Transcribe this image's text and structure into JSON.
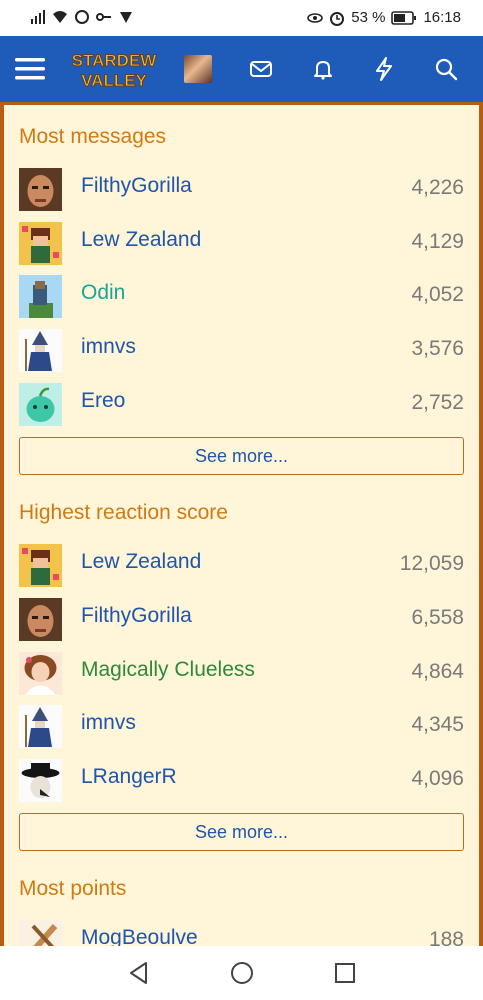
{
  "status": {
    "battery": "53 %",
    "time": "16:18"
  },
  "nav": {
    "logo_line1": "STARDEW",
    "logo_line2": "VALLEY"
  },
  "sections": [
    {
      "title": "Most messages",
      "rows": [
        {
          "name": "FilthyGorilla",
          "value": "4,226",
          "style": "blue",
          "avatar": "face"
        },
        {
          "name": "Lew Zealand",
          "value": "4,129",
          "style": "blue",
          "avatar": "yellow"
        },
        {
          "name": "Odin",
          "value": "4,052",
          "style": "teal",
          "avatar": "sky"
        },
        {
          "name": "imnvs",
          "value": "3,576",
          "style": "blue",
          "avatar": "wizard"
        },
        {
          "name": "Ereo",
          "value": "2,752",
          "style": "blue",
          "avatar": "junimo"
        }
      ],
      "see_more": "See more..."
    },
    {
      "title": "Highest reaction score",
      "rows": [
        {
          "name": "Lew Zealand",
          "value": "12,059",
          "style": "blue",
          "avatar": "yellow"
        },
        {
          "name": "FilthyGorilla",
          "value": "6,558",
          "style": "blue",
          "avatar": "face"
        },
        {
          "name": "Magically Clueless",
          "value": "4,864",
          "style": "green",
          "avatar": "girl"
        },
        {
          "name": "imnvs",
          "value": "4,345",
          "style": "blue",
          "avatar": "wizard"
        },
        {
          "name": "LRangerR",
          "value": "4,096",
          "style": "blue",
          "avatar": "hat"
        }
      ],
      "see_more": "See more..."
    },
    {
      "title": "Most points",
      "rows": [
        {
          "name": "MogBeoulve",
          "value": "188",
          "style": "blue",
          "avatar": "tan"
        }
      ]
    }
  ],
  "colors": {
    "accent": "#1f5bb8",
    "section_title": "#d17a14",
    "border": "#b55d12",
    "bg": "#fff5d8",
    "link": "#1f55aa"
  }
}
